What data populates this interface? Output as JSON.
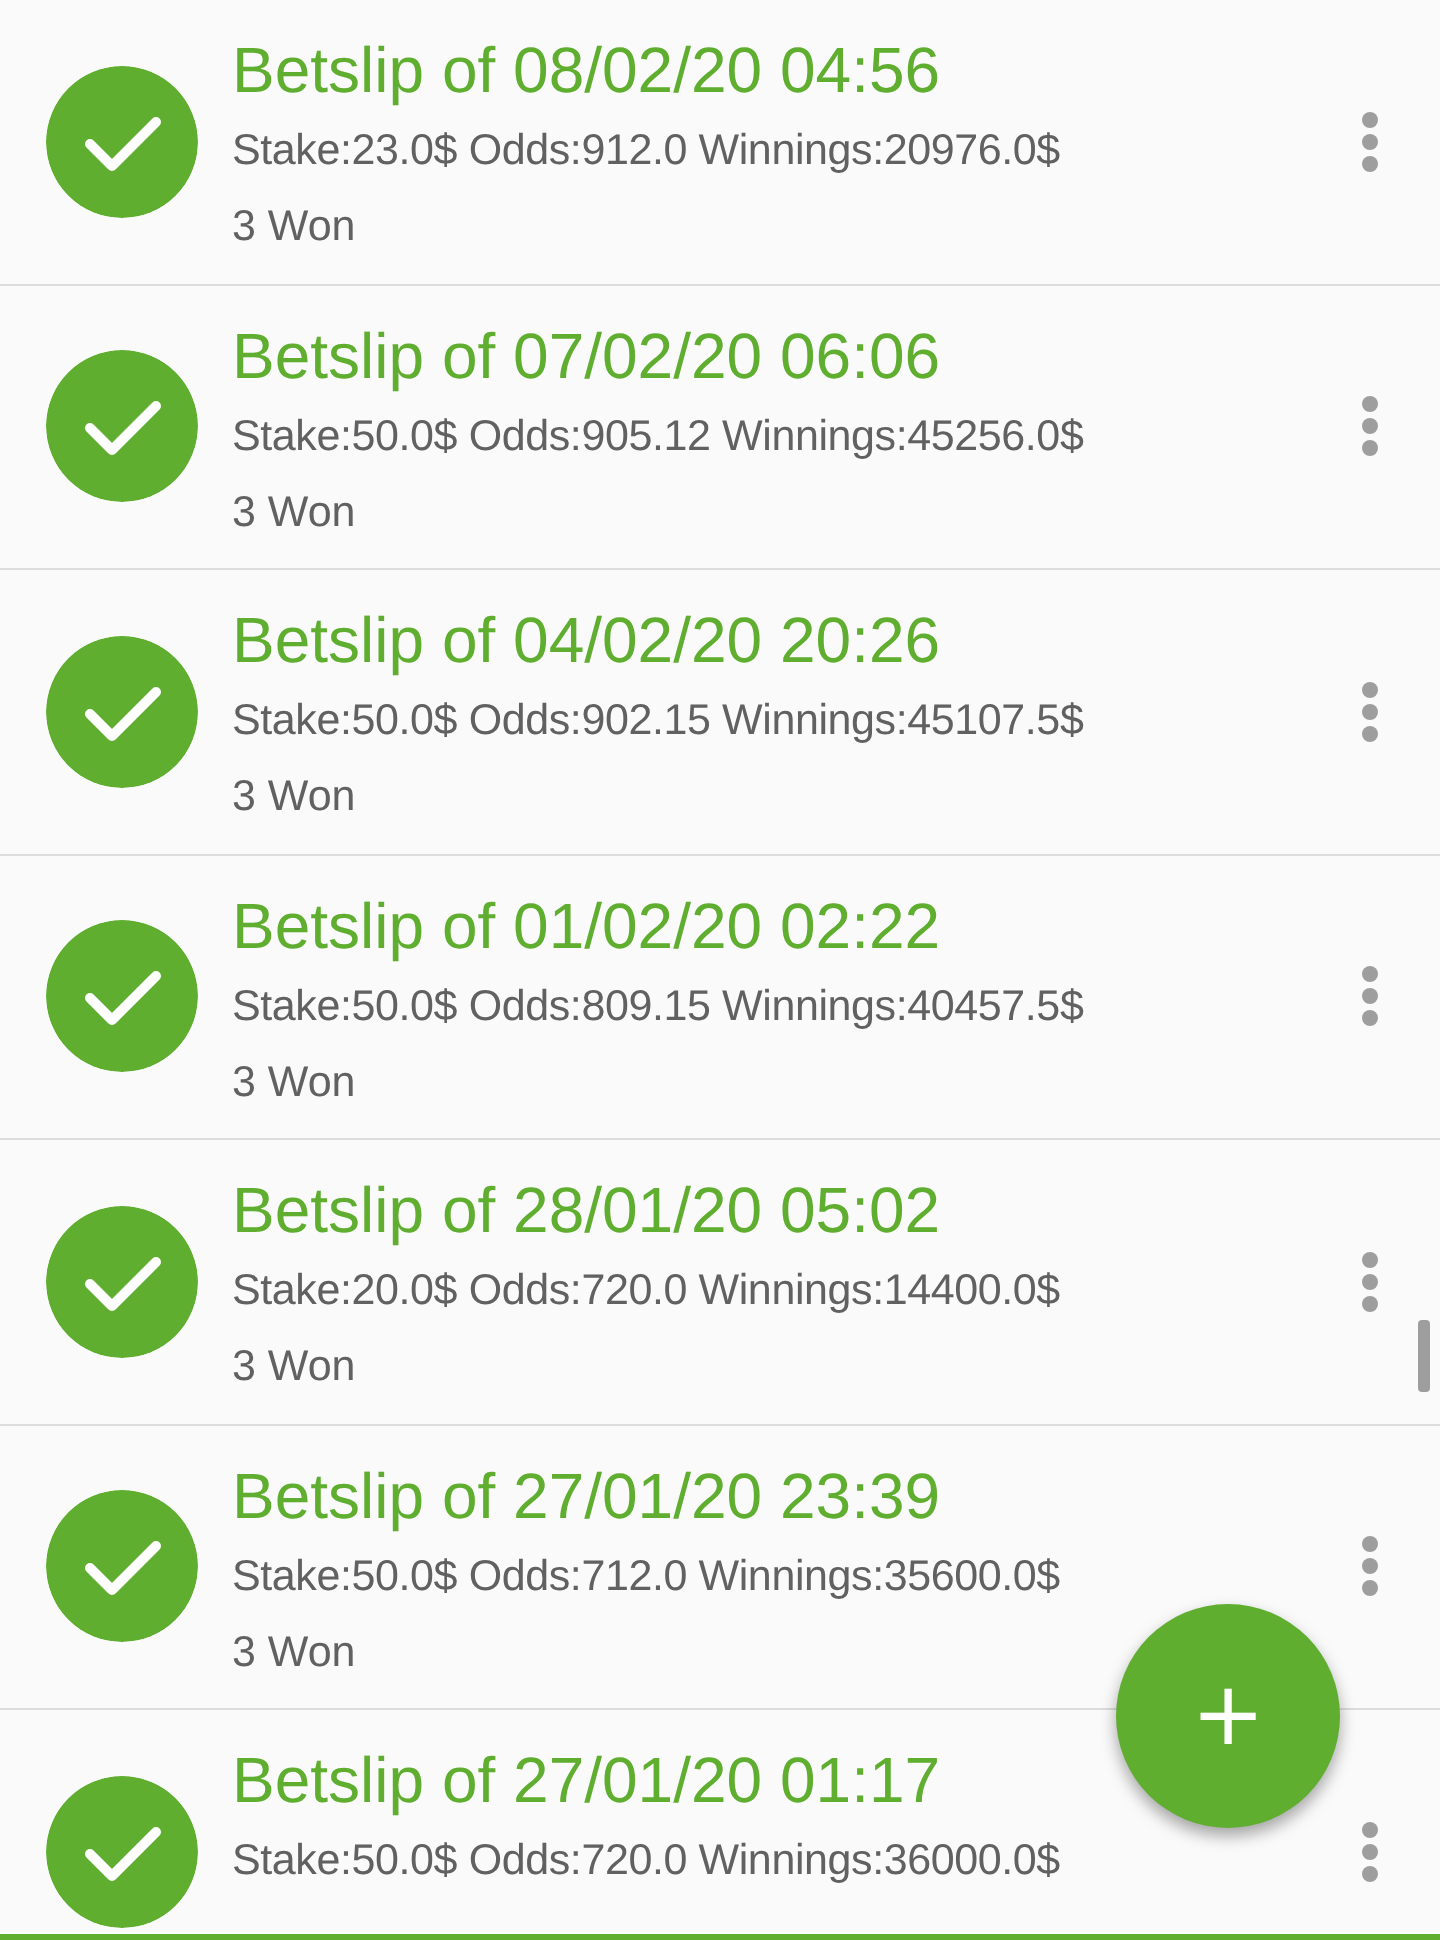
{
  "betslips": [
    {
      "title": "Betslip of 08/02/20 04:56",
      "details": "Stake:23.0$ Odds:912.0 Winnings:20976.0$",
      "result": "3 Won",
      "kind": "won"
    },
    {
      "title": "Betslip of 07/02/20 06:06",
      "details": "Stake:50.0$ Odds:905.12 Winnings:45256.0$",
      "result": "3 Won",
      "kind": "won"
    },
    {
      "title": "Betslip of 04/02/20 20:26",
      "details": "Stake:50.0$ Odds:902.15 Winnings:45107.5$",
      "result": "3 Won",
      "kind": "won"
    },
    {
      "title": "Betslip of 01/02/20 02:22",
      "details": "Stake:50.0$ Odds:809.15 Winnings:40457.5$",
      "result": "3 Won",
      "kind": "won"
    },
    {
      "title": "Betslip of 28/01/20 05:02",
      "details": "Stake:20.0$ Odds:720.0 Winnings:14400.0$",
      "result": "3 Won",
      "kind": "won"
    },
    {
      "title": "Betslip of 27/01/20 23:39",
      "details": "Stake:50.0$ Odds:712.0 Winnings:35600.0$",
      "result": "3 Won",
      "kind": "won"
    },
    {
      "title": "Betslip of 27/01/20 01:17",
      "details": "Stake:50.0$ Odds:720.0 Winnings:36000.0$",
      "kind": "won"
    }
  ],
  "fab": {
    "label": "+"
  }
}
